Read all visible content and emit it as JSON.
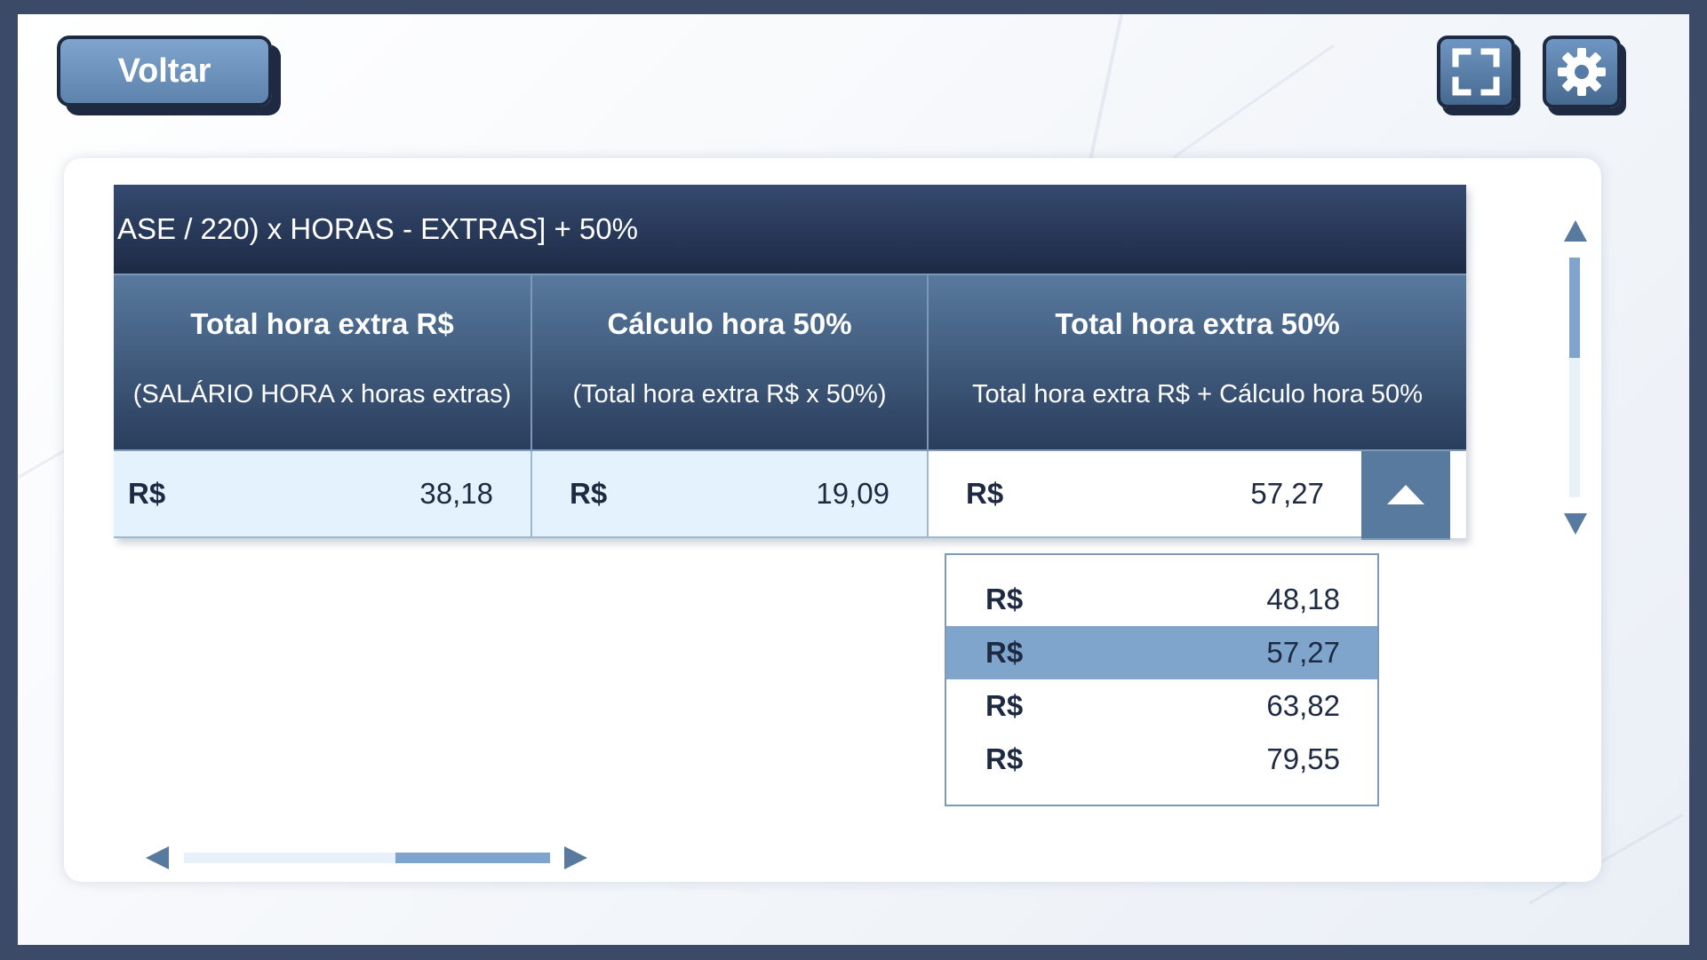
{
  "toolbar": {
    "back_label": "Voltar",
    "fullscreen_icon": "fullscreen-icon",
    "settings_icon": "gear-icon"
  },
  "table": {
    "formula": "ASE / 220) x HORAS - EXTRAS] + 50%",
    "columns": [
      {
        "title": "Total hora extra R$",
        "subtitle": "(SALÁRIO HORA x horas extras)"
      },
      {
        "title": "Cálculo hora 50%",
        "subtitle": "(Total hora extra R$ x 50%)"
      },
      {
        "title": "Total hora extra 50%",
        "subtitle": "Total hora extra R$ + Cálculo hora 50%"
      }
    ],
    "row": [
      {
        "currency": "R$",
        "value": "38,18"
      },
      {
        "currency": "R$",
        "value": "19,09"
      },
      {
        "currency": "R$",
        "value": "57,27"
      }
    ]
  },
  "dropdown": {
    "options": [
      {
        "currency": "R$",
        "value": "48,18"
      },
      {
        "currency": "R$",
        "value": "57,27"
      },
      {
        "currency": "R$",
        "value": "63,82"
      },
      {
        "currency": "R$",
        "value": "79,55"
      }
    ],
    "selected_index": 1
  },
  "colors": {
    "header_dark": "#1d2a44",
    "header_mid": "#587a9e",
    "selected": "#7fa5cc",
    "cell_bg": "#e3f2fc"
  }
}
